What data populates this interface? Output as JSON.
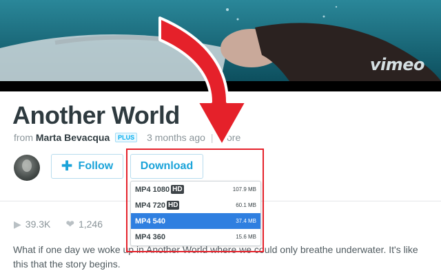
{
  "banner": {
    "logo_text": "vimeo"
  },
  "video": {
    "title": "Another World",
    "from_label": "from",
    "author": "Marta Bevacqua",
    "author_badge": "PLUS",
    "age": "3 months ago",
    "more_label": "More"
  },
  "actions": {
    "follow_label": "Follow",
    "download_label": "Download"
  },
  "download_menu": {
    "items": [
      {
        "label": "MP4 1080",
        "hd": "HD",
        "size": "107.9 MB",
        "selected": false
      },
      {
        "label": "MP4 720",
        "hd": "HD",
        "size": "60.1 MB",
        "selected": false
      },
      {
        "label": "MP4 540",
        "hd": "",
        "size": "37.4 MB",
        "selected": true
      },
      {
        "label": "MP4 360",
        "hd": "",
        "size": "15.6 MB",
        "selected": false
      }
    ]
  },
  "stats": {
    "plays": "39.3K",
    "likes": "1,246"
  },
  "description": "What if one day we woke up in Another World where we could only breathe underwater. It's like this that the story begins.",
  "colors": {
    "accent": "#1aa3d9",
    "highlight": "#e5212a",
    "selected_row": "#2f7fe0"
  },
  "icons": [
    "play-icon",
    "heart-icon",
    "plus-icon",
    "red-arrow-icon"
  ]
}
